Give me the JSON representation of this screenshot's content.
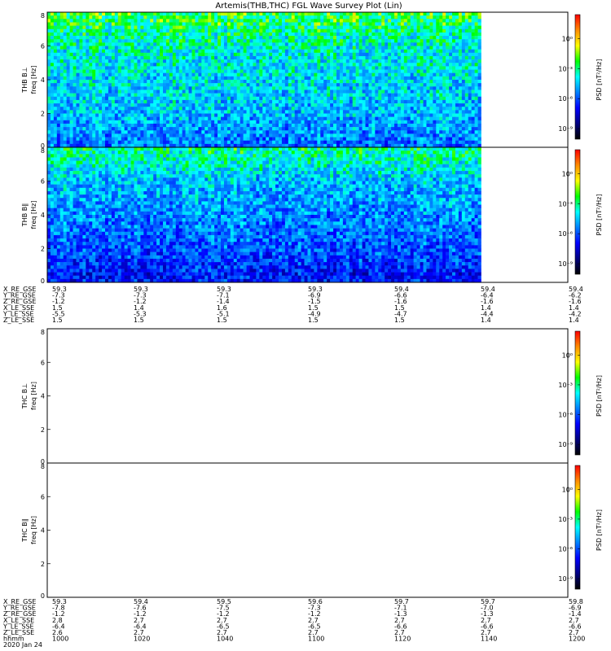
{
  "title": "Artemis(THB,THC) FGL Wave Survey Plot (Lin)",
  "panels": [
    {
      "label": "THB B⊥",
      "ylabel": "freq [Hz]",
      "has_data": true,
      "ylim": [
        0,
        8
      ]
    },
    {
      "label": "THB B∥",
      "ylabel": "freq [Hz]",
      "has_data": true,
      "ylim": [
        0,
        8
      ]
    },
    {
      "label": "THC B⊥",
      "ylabel": "freq [Hz]",
      "has_data": false,
      "ylim": [
        0,
        8
      ]
    },
    {
      "label": "THC B∥",
      "ylabel": "freq [Hz]",
      "has_data": false,
      "ylim": [
        0,
        8
      ]
    }
  ],
  "y_ticks": [
    "0",
    "2",
    "4",
    "6",
    "8"
  ],
  "colorbar": {
    "label": "PSD [nT²/Hz]",
    "ticks": [
      "10⁰",
      "10⁻³",
      "10⁻⁶",
      "10⁻⁹"
    ],
    "colors": [
      "#ff0000",
      "#ff8c00",
      "#ffff00",
      "#00ff00",
      "#00ffff",
      "#0080ff",
      "#0000ff",
      "#000080",
      "#000000"
    ]
  },
  "ephem_top": {
    "labels": [
      "X_RE_GSE",
      "Y_RE_GSE",
      "Z_RE_GSE",
      "X_LE_SSE",
      "Y_LE_SSE",
      "Z_LE_SSE"
    ],
    "columns": [
      [
        "59.3",
        "-7.3",
        "-1.2",
        "1.5",
        "-5.5",
        "1.5"
      ],
      [
        "59.3",
        "-7.3",
        "-1.2",
        "1.4",
        "-5.3",
        "1.5"
      ],
      [
        "59.3",
        "-7.1",
        "-1.4",
        "1.6",
        "-5.1",
        "1.5"
      ],
      [
        "59.3",
        "-6.9",
        "-1.5",
        "1.5",
        "-4.9",
        "1.5"
      ],
      [
        "59.4",
        "-6.6",
        "-1.6",
        "1.5",
        "-4.7",
        "1.5"
      ],
      [
        "59.4",
        "-6.4",
        "-1.6",
        "1.4",
        "-4.4",
        "1.4"
      ],
      [
        "59.4",
        "-6.2",
        "-1.6",
        "1.4",
        "-4.2",
        "1.4"
      ]
    ]
  },
  "ephem_bottom": {
    "labels": [
      "X_RE_GSE",
      "Y_RE_GSE",
      "Z_RE_GSE",
      "X_LE_SSE",
      "Y_LE_SSE",
      "Z_LE_SSE",
      "hhmm",
      "2020 Jan 24"
    ],
    "columns": [
      [
        "59.3",
        "-7.8",
        "-1.2",
        "2.8",
        "-6.4",
        "2.6",
        "1000"
      ],
      [
        "59.4",
        "-7.6",
        "-1.2",
        "2.7",
        "-6.4",
        "2.7",
        "1020"
      ],
      [
        "59.5",
        "-7.5",
        "-1.2",
        "2.7",
        "-6.5",
        "2.7",
        "1040"
      ],
      [
        "59.6",
        "-7.3",
        "-1.2",
        "2.7",
        "-6.5",
        "2.7",
        "1100"
      ],
      [
        "59.7",
        "-7.1",
        "-1.3",
        "2.7",
        "-6.6",
        "2.7",
        "1120"
      ],
      [
        "59.7",
        "-7.0",
        "-1.3",
        "2.7",
        "-6.6",
        "2.7",
        "1140"
      ],
      [
        "59.8",
        "-6.9",
        "-1.4",
        "2.7",
        "-6.6",
        "2.7",
        "1200"
      ]
    ]
  },
  "chart_data": {
    "type": "heatmap",
    "title": "Artemis(THB,THC) FGL Wave Survey Plot (Lin)",
    "x": [
      "1000",
      "1020",
      "1040",
      "1100",
      "1120",
      "1140",
      "1200"
    ],
    "xlabel": "hhmm",
    "ylabel": "freq [Hz]",
    "ylim": [
      0,
      8
    ],
    "colorbar_label": "PSD [nT²/Hz]",
    "colorbar_ticks": [
      "10⁰",
      "10⁻³",
      "10⁻⁶",
      "10⁻⁹"
    ],
    "data_end": "1140",
    "series": [
      {
        "name": "THB B⊥",
        "freq_profile": [
          [
            0.0,
            0.35
          ],
          [
            0.3,
            0.35
          ],
          [
            1.0,
            0.4
          ],
          [
            2.0,
            0.45
          ],
          [
            4.0,
            0.5
          ],
          [
            6.0,
            0.55
          ],
          [
            7.0,
            0.62
          ],
          [
            8.0,
            0.7
          ]
        ]
      },
      {
        "name": "THB B∥",
        "freq_profile": [
          [
            0.0,
            0.2
          ],
          [
            0.5,
            0.2
          ],
          [
            2.0,
            0.3
          ],
          [
            4.0,
            0.38
          ],
          [
            6.0,
            0.45
          ],
          [
            7.0,
            0.55
          ],
          [
            8.0,
            0.62
          ]
        ]
      },
      {
        "name": "THC B⊥",
        "freq_profile": []
      },
      {
        "name": "THC B∥",
        "freq_profile": []
      }
    ]
  }
}
